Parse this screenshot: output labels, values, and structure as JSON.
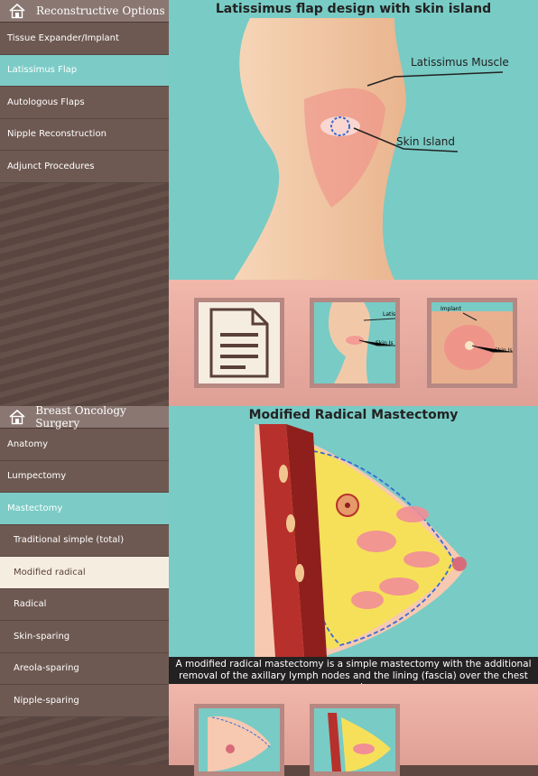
{
  "top_section": {
    "header": "Reconstructive Options",
    "items": [
      {
        "label": "Tissue Expander/Implant",
        "active": false
      },
      {
        "label": "Latissimus Flap",
        "active": true
      },
      {
        "label": "Autologous Flaps",
        "active": false
      },
      {
        "label": "Nipple Reconstruction",
        "active": false
      },
      {
        "label": "Adjunct Procedures",
        "active": false
      }
    ],
    "title": "Latissimus flap design with skin island",
    "labels": {
      "muscle": "Latissimus Muscle",
      "skin": "Skin Island"
    },
    "thumbs": {
      "t2_labels": [
        "Latis",
        "Skin Is"
      ],
      "t3_labels": [
        "Implant",
        "Skin Is"
      ]
    }
  },
  "bottom_section": {
    "header": "Breast Oncology Surgery",
    "items": [
      {
        "label": "Anatomy",
        "active": false,
        "sub": false
      },
      {
        "label": "Lumpectomy",
        "active": false,
        "sub": false
      },
      {
        "label": "Mastectomy",
        "active": true,
        "sub": false
      },
      {
        "label": "Traditional simple (total)",
        "active": false,
        "sub": true
      },
      {
        "label": "Modified radical",
        "active": true,
        "sub": true
      },
      {
        "label": "Radical",
        "active": false,
        "sub": true
      },
      {
        "label": "Skin-sparing",
        "active": false,
        "sub": true
      },
      {
        "label": "Areola-sparing",
        "active": false,
        "sub": true
      },
      {
        "label": "Nipple-sparing",
        "active": false,
        "sub": true
      }
    ],
    "title": "Modified Radical Mastectomy",
    "caption_line1": "A modified radical mastectomy is a simple mastectomy with the additional",
    "caption_line2": "removal of the axillary lymph nodes and the lining (fascia) over the chest muscl..."
  }
}
